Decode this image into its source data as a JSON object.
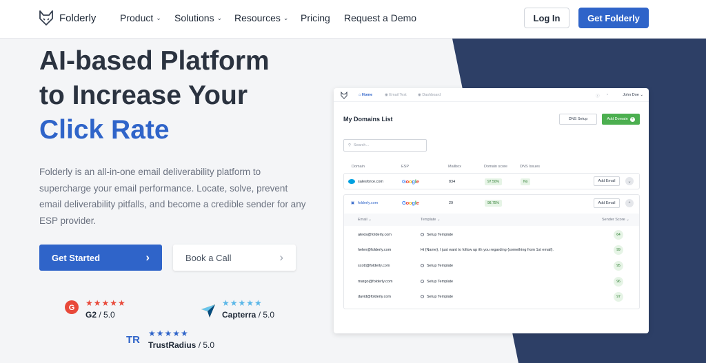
{
  "nav": {
    "brand": "Folderly",
    "items": [
      {
        "label": "Product",
        "has_dropdown": true
      },
      {
        "label": "Solutions",
        "has_dropdown": true
      },
      {
        "label": "Resources",
        "has_dropdown": true
      },
      {
        "label": "Pricing",
        "has_dropdown": false
      },
      {
        "label": "Request a Demo",
        "has_dropdown": false
      }
    ],
    "login_label": "Log In",
    "cta_label": "Get Folderly"
  },
  "hero": {
    "title_line1": "AI-based Platform",
    "title_line2": "to Increase Your",
    "title_accent": "Click Rate",
    "description": "Folderly is an all-in-one email deliverability platform to supercharge your email performance. Locate, solve, prevent email deliverability pitfalls, and become a credible sender for any ESP provider.",
    "primary_button": "Get Started",
    "secondary_button": "Book a Call"
  },
  "ratings": [
    {
      "name": "G2",
      "score": "5.0",
      "star_color": "#e8493a"
    },
    {
      "name": "Capterra",
      "score": "5.0",
      "star_color": "#5bb7e8"
    },
    {
      "name": "TrustRadius",
      "score": "5.0",
      "star_color": "#2f64c9"
    }
  ],
  "dashboard": {
    "nav_items": [
      "Home",
      "Email Test",
      "Dashboard"
    ],
    "user": "John Doe",
    "title": "My Domains List",
    "dns_button": "DNS Setup",
    "add_domain_button": "Add Domain",
    "search_placeholder": "Search...",
    "columns": [
      "Domain",
      "ESP",
      "Mailbox",
      "Domain score",
      "DNS Issues"
    ],
    "domains": [
      {
        "domain": "salesforce.com",
        "esp": "Google",
        "mailbox": "834",
        "score": "97.50%",
        "dns": "No",
        "action": "Add Email"
      },
      {
        "domain": "folderly.com",
        "esp": "Google",
        "mailbox": "29",
        "score": "98.75%",
        "dns": "",
        "action": "Add Email"
      }
    ],
    "sub_columns": [
      "Email",
      "Template",
      "Sender Score"
    ],
    "emails": [
      {
        "email": "alexis@folderly.com",
        "template": "Setup Template",
        "score": "64"
      },
      {
        "email": "helen@folderly.com",
        "template": "Hi {Name}, I just want to follow up ith you regarding {something from 1st email}.",
        "score": "99"
      },
      {
        "email": "scott@folderly.com",
        "template": "Setup Template",
        "score": "95"
      },
      {
        "email": "margo@folderly.com",
        "template": "Setup Template",
        "score": "96"
      },
      {
        "email": "david@folderly.com",
        "template": "Setup Template",
        "score": "97"
      }
    ]
  },
  "colors": {
    "accent": "#2f64c9",
    "dark_panel": "#2d3f66",
    "success": "#4caf50"
  }
}
